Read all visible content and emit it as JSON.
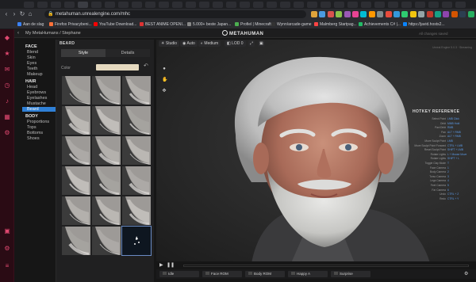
{
  "browser": {
    "url": "metahuman.unrealengine.com/mhc",
    "bookmarks": [
      "Aan de slag",
      "Firefox Privacybeni...",
      "YouTube Download...",
      "BEST ANIME OPENI...",
      "5.000+ beste Japan...",
      "Profiel | Minecraft",
      "Wynn/arcade-game",
      "Malmberg Startpag...",
      "Achievements C# |...",
      "https://javid.hosts2..."
    ],
    "nav_icons": [
      "back-icon",
      "forward-icon",
      "reload-icon",
      "home-icon"
    ]
  },
  "app": {
    "breadcrumb": "My MetaHumans / Stephane",
    "logo_text": "METAHUMAN",
    "autosave_text": "All changes saved"
  },
  "categories": {
    "face": {
      "label": "FACE",
      "items": [
        "Blend",
        "Skin",
        "Eyes",
        "Teeth",
        "Makeup"
      ]
    },
    "hair": {
      "label": "HAIR",
      "items": [
        "Head",
        "Eyebrows",
        "Eyelashes",
        "Mustache",
        "Beard"
      ],
      "selected": "Beard"
    },
    "body": {
      "label": "BODY",
      "items": [
        "Proportions",
        "Tops",
        "Bottoms",
        "Shoes"
      ]
    }
  },
  "beard_panel": {
    "title": "BEARD",
    "tabs": [
      "Style",
      "Details"
    ],
    "active_tab": "Style",
    "color_label": "Color",
    "color_value": "#e5d9bf",
    "reset_icon": "undo-icon"
  },
  "viewport": {
    "toolbar": [
      "Studio",
      "Auto",
      "Medium",
      "LOD 0"
    ],
    "render_info": "Unreal Engine 5.0.3 · Streaming",
    "hotkeys": {
      "title": "HOTKEY REFERENCE",
      "rows": [
        {
          "label": "Select Point",
          "value": "LMB Click"
        },
        {
          "label": "Orbit",
          "value": "MMB Hold"
        },
        {
          "label": "Pan/Orbit",
          "value": "RMB"
        },
        {
          "label": "Pan",
          "value": "ALT + RMB"
        },
        {
          "label": "Zoom",
          "value": "ALT + RMB"
        },
        {
          "label": "Move Sculpt Point",
          "value": "LMB"
        },
        {
          "label": "Move Sculpt Point Forward",
          "value": "CTRL + LMB"
        },
        {
          "label": "Reset Sculpt Point",
          "value": "SHIFT + LMB"
        },
        {
          "label": "Rotate Lights",
          "value": "L + Mouse Move"
        },
        {
          "label": "Rotate Lights",
          "value": "SHIFT + L"
        },
        {
          "label": "Toggle Clay Mode",
          "value": "T"
        },
        {
          "label": "Face Camera",
          "value": "1"
        },
        {
          "label": "Body Camera",
          "value": "2"
        },
        {
          "label": "Torso Camera",
          "value": "3"
        },
        {
          "label": "Legs Camera",
          "value": "4"
        },
        {
          "label": "Feet Camera",
          "value": "5"
        },
        {
          "label": "Far Camera",
          "value": "6"
        },
        {
          "label": "Undo",
          "value": "CTRL + Z"
        },
        {
          "label": "Redo",
          "value": "CTRL + Y"
        }
      ]
    }
  },
  "timeline": {
    "controls": [
      "play-icon",
      "pause-icon"
    ],
    "animations": [
      "Idle",
      "Face ROM",
      "Body ROM",
      "Happy A",
      "Surprise"
    ]
  },
  "os_sidebar": {
    "icons": [
      "apps-icon",
      "star-icon",
      "message-icon",
      "clock-icon",
      "bell-icon",
      "grid-icon",
      "settings-icon"
    ]
  }
}
